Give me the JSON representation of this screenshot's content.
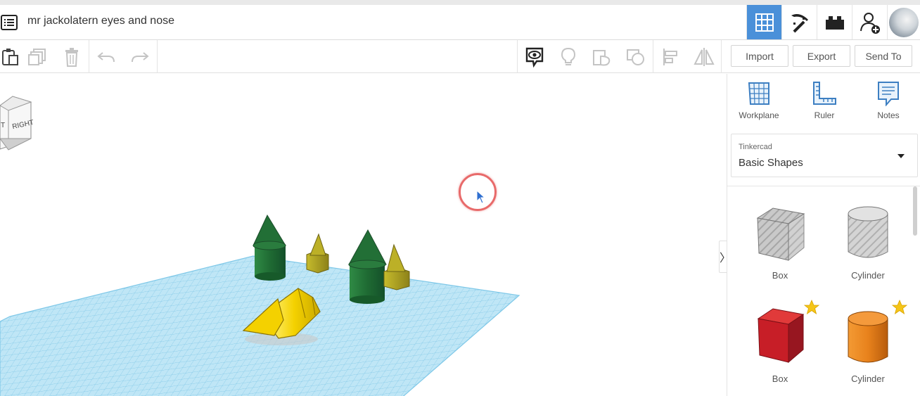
{
  "header": {
    "title": "mr jackolatern eyes and nose"
  },
  "toolbar": {
    "import_label": "Import",
    "export_label": "Export",
    "send_to_label": "Send To"
  },
  "viewcube": {
    "right_label": "RIGHT",
    "left_fragment": "T"
  },
  "panel": {
    "tools": [
      {
        "label": "Workplane",
        "icon": "workplane-icon"
      },
      {
        "label": "Ruler",
        "icon": "ruler-icon"
      },
      {
        "label": "Notes",
        "icon": "notes-icon"
      }
    ],
    "library": {
      "provider": "Tinkercad",
      "selected": "Basic Shapes"
    },
    "shapes": [
      {
        "label": "Box",
        "style": "hole",
        "starred": false
      },
      {
        "label": "Cylinder",
        "style": "hole",
        "starred": false
      },
      {
        "label": "Box",
        "color": "#d0202b",
        "starred": true
      },
      {
        "label": "Cylinder",
        "color": "#e8821c",
        "starred": true
      }
    ]
  },
  "collapse_glyph": "〉",
  "colors": {
    "accent": "#4a90d9",
    "workplane": "#9fd6ee",
    "green_shape": "#1f6b33",
    "olive_shape": "#a69b1e",
    "yellow_shape": "#f4d100"
  }
}
